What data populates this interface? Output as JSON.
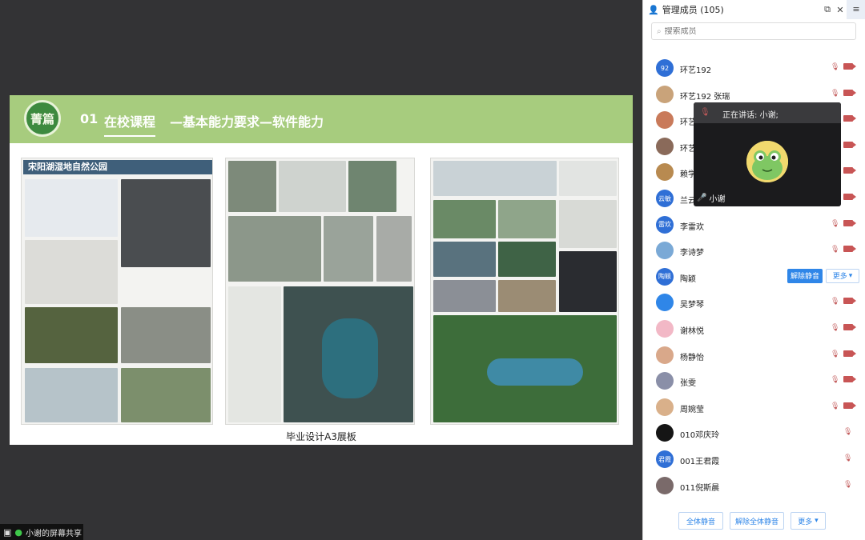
{
  "slide": {
    "logo_text": "菁篇",
    "section_number": "01",
    "section_title": "在校课程",
    "section_subtitle": "—基本能力要求—软件能力",
    "board1_title": "宋阳湖湿地自然公园",
    "caption": "毕业设计A3展板"
  },
  "share_bar": {
    "label": "小谢的屏幕共享"
  },
  "panel": {
    "title": "管理成员 (105)",
    "search_placeholder": "搜索成员",
    "members": [
      {
        "name": "环艺192",
        "avatar_text": "92",
        "avatar_color": "#2f6fd6"
      },
      {
        "name": "环艺192 张瑞",
        "avatar_text": "",
        "avatar_color": "#c9a37a"
      },
      {
        "name": "环艺",
        "avatar_text": "",
        "avatar_color": "#c97a5a"
      },
      {
        "name": "环艺",
        "avatar_text": "",
        "avatar_color": "#8a6a5a"
      },
      {
        "name": "赖学",
        "avatar_text": "",
        "avatar_color": "#b88a50"
      },
      {
        "name": "兰云",
        "avatar_text": "云敏",
        "avatar_color": "#2f6fd6"
      },
      {
        "name": "李雷欢",
        "avatar_text": "雷欢",
        "avatar_color": "#2f6fd6"
      },
      {
        "name": "李诗梦",
        "avatar_text": "",
        "avatar_color": "#7aa9d6"
      },
      {
        "name": "陶颖",
        "avatar_text": "陶颖",
        "avatar_color": "#2f6fd6"
      },
      {
        "name": "吴梦琴",
        "avatar_text": "",
        "avatar_color": "#2f86e8"
      },
      {
        "name": "谢林悦",
        "avatar_text": "",
        "avatar_color": "#f2b8c6"
      },
      {
        "name": "杨静怡",
        "avatar_text": "",
        "avatar_color": "#d9a88a"
      },
      {
        "name": "张雯",
        "avatar_text": "",
        "avatar_color": "#8a8fa8"
      },
      {
        "name": "周婉莹",
        "avatar_text": "",
        "avatar_color": "#d9b08a"
      },
      {
        "name": "010邓庆玲",
        "avatar_text": "",
        "avatar_color": "#151515"
      },
      {
        "name": "001王君霞",
        "avatar_text": "君霞",
        "avatar_color": "#2f6fd6"
      },
      {
        "name": "011倪斯晨",
        "avatar_text": "",
        "avatar_color": "#7a6a6a"
      }
    ],
    "unmute_label": "解除静音",
    "more_label": "更多",
    "speaker": {
      "label": "正在讲话: 小谢;",
      "name": "小谢"
    },
    "footer": {
      "mute_all": "全体静音",
      "unmute_all": "解除全体静音",
      "more": "更多"
    }
  },
  "colors": {
    "slide_header": "#a7cc7e",
    "accent_blue": "#2f86e8",
    "muted_red": "#c85555",
    "mic_green": "#3ec84a"
  }
}
